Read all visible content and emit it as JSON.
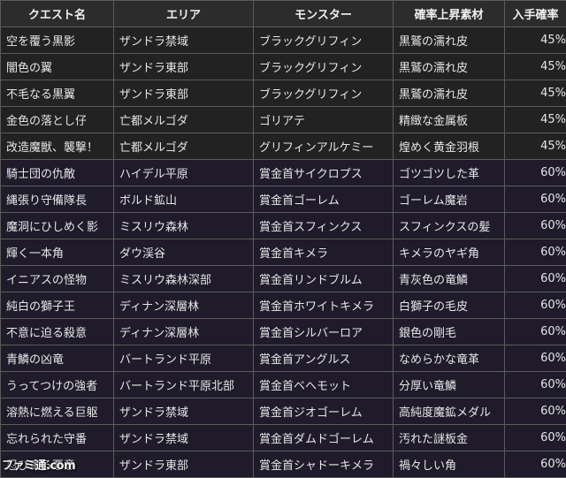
{
  "table": {
    "headers": [
      "クエスト名",
      "エリア",
      "モンスター",
      "確率上昇素材",
      "入手確率"
    ],
    "rows": [
      {
        "quest": "空を覆う黒影",
        "area": "ザンドラ禁域",
        "monster": "ブラックグリフィン",
        "material": "黒鷲の濡れ皮",
        "rate": "45%"
      },
      {
        "quest": "闇色の翼",
        "area": "ザンドラ東部",
        "monster": "ブラックグリフィン",
        "material": "黒鷲の濡れ皮",
        "rate": "45%"
      },
      {
        "quest": "不毛なる黒翼",
        "area": "ザンドラ東部",
        "monster": "ブラックグリフィン",
        "material": "黒鷲の濡れ皮",
        "rate": "45%"
      },
      {
        "quest": "金色の落とし仔",
        "area": "亡都メルゴダ",
        "monster": "ゴリアテ",
        "material": "精緻な金属板",
        "rate": "45%"
      },
      {
        "quest": "改造魔獣、襲撃！",
        "area": "亡都メルゴダ",
        "monster": "グリフィンアルケミー",
        "material": "煌めく黄金羽根",
        "rate": "45%"
      },
      {
        "quest": "騎士団の仇敵",
        "area": "ハイデル平原",
        "monster": "賞金首サイクロプス",
        "material": "ゴツゴツした革",
        "rate": "60%"
      },
      {
        "quest": "縄張り守備隊長",
        "area": "ボルド鉱山",
        "monster": "賞金首ゴーレム",
        "material": "ゴーレム魔岩",
        "rate": "60%"
      },
      {
        "quest": "魔洞にひしめく影",
        "area": "ミスリウ森林",
        "monster": "賞金首スフィンクス",
        "material": "スフィンクスの髪",
        "rate": "60%"
      },
      {
        "quest": "輝く一本角",
        "area": "ダウ渓谷",
        "monster": "賞金首キメラ",
        "material": "キメラのヤギ角",
        "rate": "60%"
      },
      {
        "quest": "イニアスの怪物",
        "area": "ミスリウ森林深部",
        "monster": "賞金首リンドブルム",
        "material": "青灰色の竜鱗",
        "rate": "60%"
      },
      {
        "quest": "純白の獅子王",
        "area": "ディナン深層林",
        "monster": "賞金首ホワイトキメラ",
        "material": "白獅子の毛皮",
        "rate": "60%"
      },
      {
        "quest": "不意に迫る殺意",
        "area": "ディナン深層林",
        "monster": "賞金首シルバーロア",
        "material": "銀色の剛毛",
        "rate": "60%"
      },
      {
        "quest": "青鱗の凶竜",
        "area": "バートランド平原",
        "monster": "賞金首アングルス",
        "material": "なめらかな竜革",
        "rate": "60%"
      },
      {
        "quest": "うってつけの強者",
        "area": "バートランド平原北部",
        "monster": "賞金首ベヘモット",
        "material": "分厚い竜鱗",
        "rate": "60%"
      },
      {
        "quest": "溶熱に燃える巨躯",
        "area": "ザンドラ禁域",
        "monster": "賞金首ジオゴーレム",
        "material": "高純度魔鉱メダル",
        "rate": "60%"
      },
      {
        "quest": "忘れられた守番",
        "area": "ザンドラ禁域",
        "monster": "賞金首ダムドゴーレム",
        "material": "汚れた謎板金",
        "rate": "60%"
      },
      {
        "quest": "忍び寄る悪意",
        "area": "ザンドラ東部",
        "monster": "賞金首シャドーキメラ",
        "material": "禍々しい角",
        "rate": "60%"
      }
    ]
  },
  "watermark": "ファミ通.com"
}
